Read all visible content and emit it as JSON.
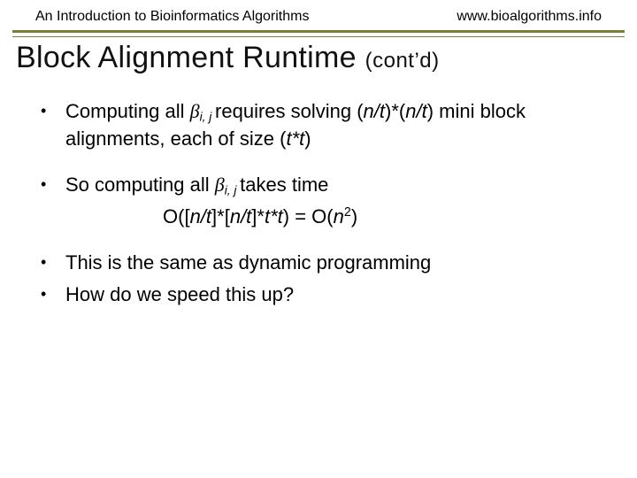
{
  "header": {
    "left": "An Introduction to Bioinformatics Algorithms",
    "right": "www.bioalgorithms.info"
  },
  "title": {
    "main": "Block Alignment Runtime ",
    "contd": "(cont’d)"
  },
  "bullets": {
    "b1_pre": "Computing all  ",
    "b1_beta": "β",
    "b1_sub": "i, j ",
    "b1_mid": "requires solving (",
    "b1_nt1": "n/t",
    "b1_star": ")*(",
    "b1_nt2": "n/t",
    "b1_post1": ") mini block alignments, each of size (",
    "b1_tt": "t*t",
    "b1_post2": ")",
    "b2_pre": "So computing  all ",
    "b2_beta": "β",
    "b2_sub": "i, j ",
    "b2_post": "takes time",
    "formula_pre": "O([",
    "formula_nt1": "n/t",
    "formula_mid1": "]*[",
    "formula_nt2": "n/t",
    "formula_mid2": "]*",
    "formula_tt": "t*t",
    "formula_mid3": ") = O(",
    "formula_n": "n",
    "formula_sup": "2",
    "formula_post": ")",
    "b3": "This is the same as dynamic programming",
    "b4": "How do we speed this up?"
  }
}
